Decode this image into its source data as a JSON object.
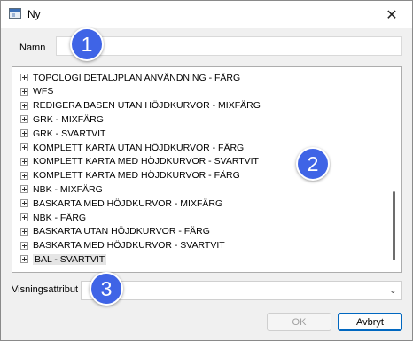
{
  "window": {
    "title": "Ny",
    "close_glyph": "✕"
  },
  "name_field": {
    "label": "Namn",
    "value": ""
  },
  "tree": {
    "items": [
      {
        "label": "TOPOLOGI DETALJPLAN ANVÄNDNING - FÄRG"
      },
      {
        "label": "WFS"
      },
      {
        "label": "REDIGERA BASEN UTAN HÖJDKURVOR - MIXFÄRG"
      },
      {
        "label": "GRK - MIXFÄRG"
      },
      {
        "label": "GRK - SVARTVIT"
      },
      {
        "label": "KOMPLETT KARTA UTAN HÖJDKURVOR - FÄRG"
      },
      {
        "label": "KOMPLETT KARTA MED HÖJDKURVOR - SVARTVIT"
      },
      {
        "label": "KOMPLETT KARTA MED HÖJDKURVOR - FÄRG"
      },
      {
        "label": "NBK - MIXFÄRG"
      },
      {
        "label": "BASKARTA MED HÖJDKURVOR - MIXFÄRG"
      },
      {
        "label": "NBK - FÄRG"
      },
      {
        "label": "BASKARTA UTAN HÖJDKURVOR - FÄRG"
      },
      {
        "label": "BASKARTA MED HÖJDKURVOR - SVARTVIT"
      },
      {
        "label": "BAL - SVARTVIT",
        "selected": true
      }
    ]
  },
  "display_attribute": {
    "label": "Visningsattribut",
    "value": ""
  },
  "buttons": {
    "ok": "OK",
    "cancel": "Avbryt"
  },
  "callouts": [
    "1",
    "2",
    "3"
  ],
  "colors": {
    "callout": "#3f64e6",
    "focus_border": "#0067c0"
  }
}
